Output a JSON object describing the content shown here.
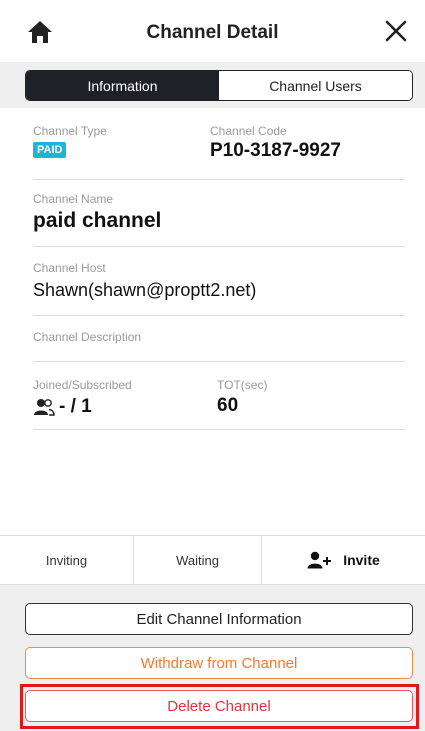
{
  "header": {
    "title": "Channel Detail",
    "home_icon": "home-icon",
    "close_icon": "close-icon"
  },
  "tabs": [
    {
      "label": "Information",
      "active": true
    },
    {
      "label": "Channel Users",
      "active": false
    }
  ],
  "info": {
    "channel_type_label": "Channel Type",
    "channel_type_value": "PAID",
    "channel_code_label": "Channel Code",
    "channel_code_value": "P10-3187-9927",
    "channel_name_label": "Channel Name",
    "channel_name_value": "paid channel",
    "channel_host_label": "Channel Host",
    "channel_host_value": "Shawn(shawn@proptt2.net)",
    "channel_description_label": "Channel Description",
    "joined_label": "Joined/Subscribed",
    "joined_value": "- / 1",
    "tot_label": "TOT(sec)",
    "tot_value": "60"
  },
  "bottom_tabs": {
    "inviting": "Inviting",
    "waiting": "Waiting",
    "invite": "Invite"
  },
  "buttons": {
    "edit": "Edit Channel Information",
    "withdraw": "Withdraw from Channel",
    "delete": "Delete Channel"
  },
  "colors": {
    "badge": "#1fb5d6",
    "active_tab": "#1e2127",
    "withdraw": "#f07a30",
    "delete": "#e8333a",
    "highlight": "#e01818"
  }
}
